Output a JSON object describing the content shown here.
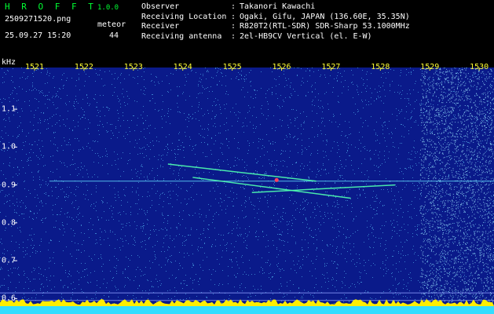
{
  "app": {
    "name": "H R O F F T",
    "version": "1.0.0"
  },
  "capture": {
    "filename": "2509271520.png",
    "datetime": "25.09.27 15:20"
  },
  "meteor": {
    "label": "meteor",
    "count": "44"
  },
  "station": [
    {
      "key": "Observer",
      "value": "Takanori Kawachi"
    },
    {
      "key": "Receiving Location",
      "value": "Ogaki, Gifu, JAPAN (136.60E, 35.35N)"
    },
    {
      "key": "Receiver",
      "value": "R820T2(RTL-SDR) SDR-Sharp 53.1000MHz"
    },
    {
      "key": "Receiving antenna",
      "value": "2el-HB9CV Vertical (el. E-W)"
    }
  ],
  "separator": ":",
  "chart_data": {
    "type": "heatmap",
    "ylabel": "kHz",
    "x_ticks": [
      "1521",
      "1522",
      "1523",
      "1524",
      "1525",
      "1526",
      "1527",
      "1528",
      "1529",
      "1530"
    ],
    "y_ticks": [
      "1.1",
      "1.0",
      "0.9",
      "0.8",
      "0.7",
      "0.6"
    ],
    "xlim": [
      1520.3,
      1530.3
    ],
    "ylim": [
      0.58,
      1.21
    ],
    "carrier_khz": 0.91,
    "meteor_echoes": [
      {
        "x": [
          1523.7,
          1526.7
        ],
        "y": [
          0.955,
          0.91
        ]
      },
      {
        "x": [
          1524.2,
          1527.4
        ],
        "y": [
          0.92,
          0.865
        ]
      },
      {
        "x": [
          1525.4,
          1528.3
        ],
        "y": [
          0.88,
          0.9
        ]
      }
    ],
    "noise_bands": [
      1528.8,
      1530.3
    ],
    "colors": {
      "background": "#0a1a8a",
      "noise": "#5fd0ff",
      "echo": "#ff4060",
      "tick": "#ffff33",
      "baseline": "#ffee00"
    }
  }
}
